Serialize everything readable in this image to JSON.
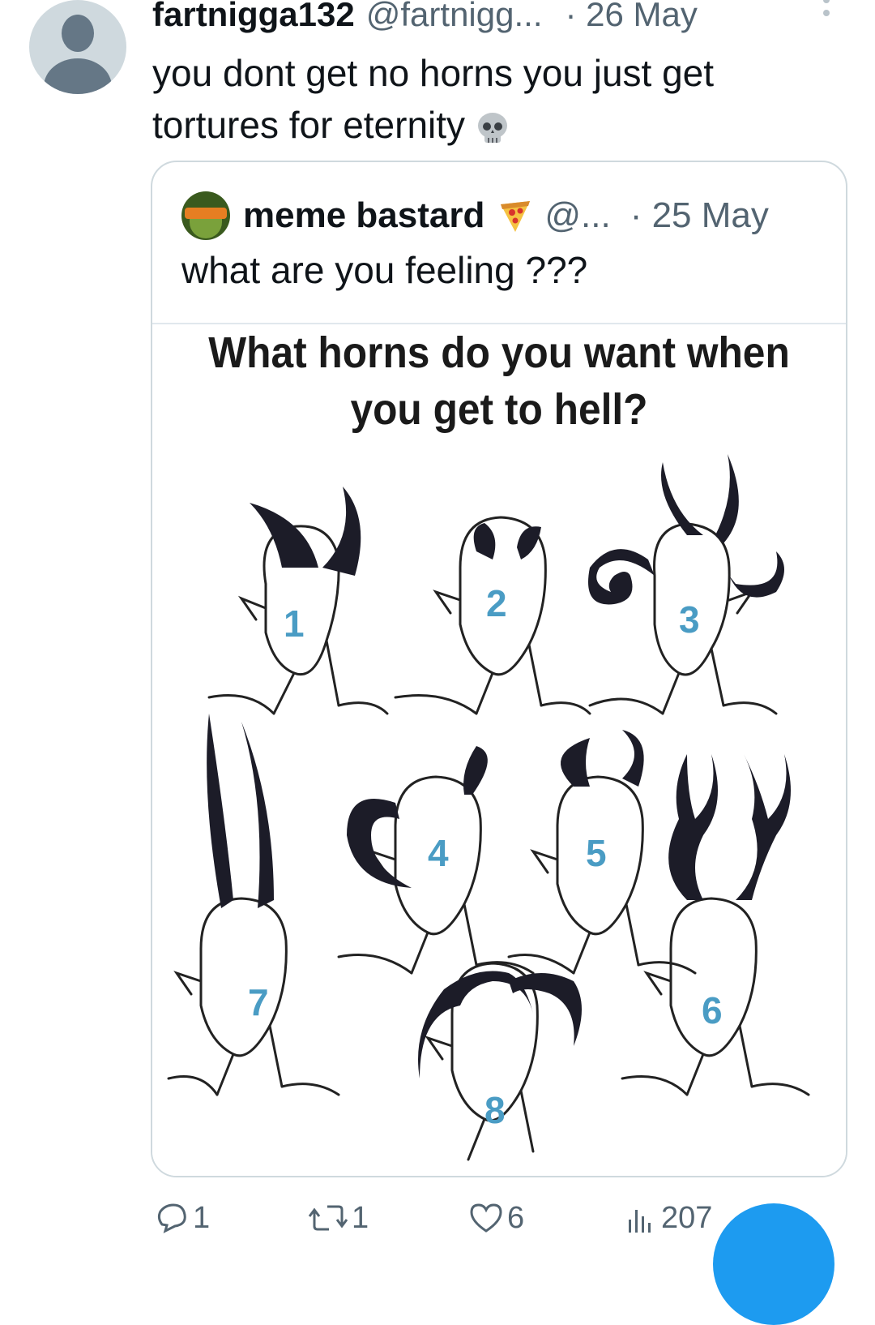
{
  "tweet": {
    "display_name": "fartnigga132",
    "handle": "@fartnigg...",
    "date": "· 26 May",
    "text": "you dont get no horns you just get tortures for eternity",
    "emoji": "skull-icon"
  },
  "quote": {
    "display_name": "meme bastard",
    "emoji": "pizza-icon",
    "handle": "@...",
    "date": "· 25 May",
    "text": "what are you feeling ???",
    "image": {
      "title": "What horns do you want when you get to hell?",
      "numbers": [
        "1",
        "2",
        "3",
        "4",
        "5",
        "6",
        "7",
        "8"
      ]
    }
  },
  "actions": {
    "replies": "1",
    "reposts": "1",
    "likes": "6",
    "views": "207"
  },
  "colors": {
    "accent": "#1d9bf0",
    "secondary_text": "#536471",
    "border": "#cfd9de",
    "number_blue": "#4a9cc4"
  }
}
